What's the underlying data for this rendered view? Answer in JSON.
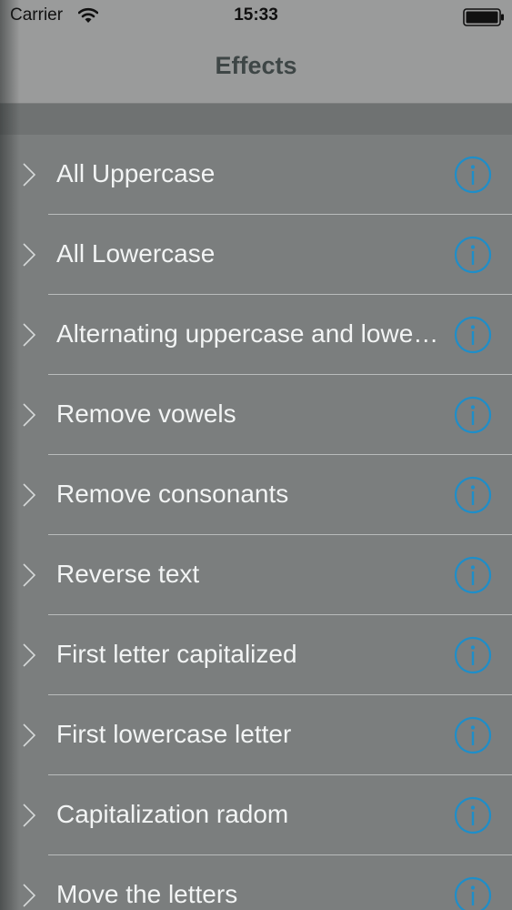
{
  "status_bar": {
    "carrier": "Carrier",
    "time": "15:33",
    "wifi_icon": "wifi-icon",
    "battery_icon": "battery-icon"
  },
  "nav": {
    "title": "Effects"
  },
  "colors": {
    "accent": "#1e8ec9",
    "row_text": "#f2f4f4",
    "background": "#7b7e7e",
    "nav_bar": "#9a9b9b"
  },
  "effects": [
    {
      "label": "All Uppercase"
    },
    {
      "label": "All Lowercase"
    },
    {
      "label": "Alternating uppercase and lowercase"
    },
    {
      "label": "Remove vowels"
    },
    {
      "label": "Remove consonants"
    },
    {
      "label": "Reverse text"
    },
    {
      "label": "First letter capitalized"
    },
    {
      "label": "First lowercase letter"
    },
    {
      "label": "Capitalization radom"
    },
    {
      "label": "Move the letters"
    }
  ]
}
